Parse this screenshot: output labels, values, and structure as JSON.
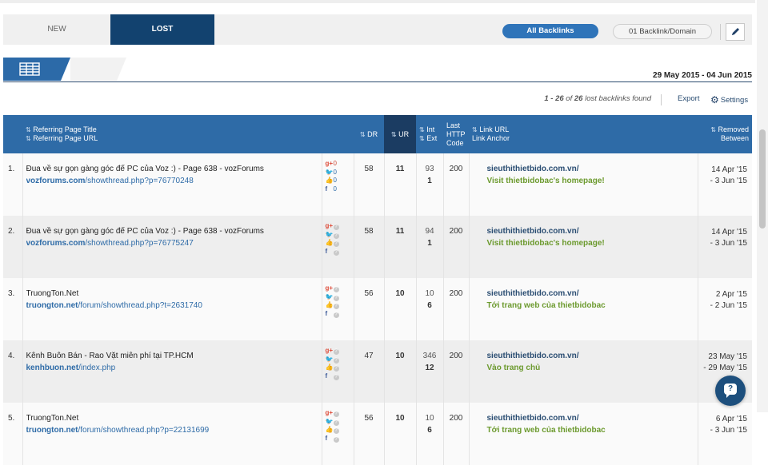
{
  "tabs": [
    {
      "label": "NEW"
    },
    {
      "label": "LOST"
    }
  ],
  "filters": {
    "all_backlinks": "All Backlinks",
    "one_per_domain": "01 Backlink/Domain"
  },
  "date_range": "29 May 2015 - 04 Jun 2015",
  "found": {
    "range": "1 - 26",
    "of": "of",
    "total": "26",
    "suffix": "lost backlinks found"
  },
  "actions": {
    "export": "Export",
    "settings": "Settings"
  },
  "columns": {
    "title": "Referring Page Title",
    "url": "Referring Page URL",
    "dr": "DR",
    "ur": "UR",
    "int": "Int",
    "ext": "Ext",
    "http_l1": "Last",
    "http_l2": "HTTP",
    "http_l3": "Code",
    "link_url": "Link URL",
    "link_anchor": "Link Anchor",
    "removed": "Removed",
    "between": "Between"
  },
  "rows": [
    {
      "num": "1.",
      "title": "Đua về sự gọn gàng góc để PC của Voz :) - Page 638 - vozForums",
      "domain": "vozforums.com",
      "path": "/showthread.php?p=76770248",
      "social": {
        "gplus": "0",
        "twitter": "0",
        "like": "0",
        "facebook": "0"
      },
      "dr": "58",
      "ur": "11",
      "int": "93",
      "ext": "1",
      "http": "200",
      "link_url": "sieuthithietbido.com.vn/",
      "anchor": "Visit thietbidobac's homepage!",
      "removed_from": "14 Apr '15",
      "removed_to": "- 3 Jun '15"
    },
    {
      "num": "2.",
      "title": "Đua về sự gọn gàng góc để PC của Voz :) - Page 638 - vozForums",
      "domain": "vozforums.com",
      "path": "/showthread.php?p=76775247",
      "social": null,
      "dr": "58",
      "ur": "11",
      "int": "94",
      "ext": "1",
      "http": "200",
      "link_url": "sieuthithietbido.com.vn/",
      "anchor": "Visit thietbidobac's homepage!",
      "removed_from": "14 Apr '15",
      "removed_to": "- 3 Jun '15"
    },
    {
      "num": "3.",
      "title": "TruongTon.Net",
      "domain": "truongton.net",
      "path": "/forum/showthread.php?t=2631740",
      "social": null,
      "dr": "56",
      "ur": "10",
      "int": "10",
      "ext": "6",
      "http": "200",
      "link_url": "sieuthithietbido.com.vn/",
      "anchor": "Tới trang web của thietbidobac",
      "removed_from": "2 Apr '15",
      "removed_to": "- 2 Jun '15"
    },
    {
      "num": "4.",
      "title": "Kênh Buôn Bán - Rao Vặt miễn phí tại TP.HCM",
      "domain": "kenhbuon.net",
      "path": "/index.php",
      "social": null,
      "dr": "47",
      "ur": "10",
      "int": "346",
      "ext": "12",
      "http": "200",
      "link_url": "sieuthithietbido.com.vn/",
      "anchor": "Vào trang chủ",
      "removed_from": "23 May '15",
      "removed_to": "- 29 May '15"
    },
    {
      "num": "5.",
      "title": "TruongTon.Net",
      "domain": "truongton.net",
      "path": "/forum/showthread.php?p=22131699",
      "social": null,
      "dr": "56",
      "ur": "10",
      "int": "10",
      "ext": "6",
      "http": "200",
      "link_url": "sieuthithietbido.com.vn/",
      "anchor": "Tới trang web của thietbidobac",
      "removed_from": "6 Apr '15",
      "removed_to": "- 3 Jun '15"
    }
  ]
}
